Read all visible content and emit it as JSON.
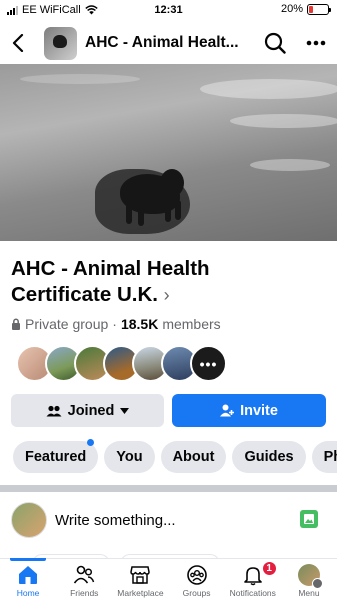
{
  "status_bar": {
    "carrier": "EE WiFiCall",
    "time": "12:31",
    "battery_percent": "20%",
    "battery_level": 0.2,
    "battery_color": "#e53935"
  },
  "header": {
    "back_icon": "chevron-left-icon",
    "title": "AHC - Animal Healt...",
    "search_icon": "search-icon",
    "more_icon": "more-horizontal-icon"
  },
  "group": {
    "name": "AHC - Animal Health Certificate U.K.",
    "privacy": "Private group",
    "separator": "·",
    "member_count": "18.5K",
    "members_label": "members",
    "more_members": "•••"
  },
  "actions": {
    "joined_label": "Joined",
    "invite_label": "Invite"
  },
  "tabs": [
    {
      "label": "Featured",
      "has_notification_dot": true
    },
    {
      "label": "You"
    },
    {
      "label": "About"
    },
    {
      "label": "Guides"
    },
    {
      "label": "Ph"
    }
  ],
  "composer": {
    "placeholder": "Write something...",
    "photo_icon": "photo-icon"
  },
  "bottom_nav": [
    {
      "label": "Home",
      "icon": "home-icon",
      "active": true
    },
    {
      "label": "Friends",
      "icon": "friends-icon"
    },
    {
      "label": "Marketplace",
      "icon": "marketplace-icon"
    },
    {
      "label": "Groups",
      "icon": "groups-icon"
    },
    {
      "label": "Notifications",
      "icon": "bell-icon",
      "badge": "1"
    },
    {
      "label": "Menu",
      "icon": "profile-avatar"
    }
  ],
  "colors": {
    "accent": "#1877f2",
    "button_grey": "#e4e6eb",
    "badge_red": "#e41e3f",
    "secondary_text": "#65676b"
  }
}
